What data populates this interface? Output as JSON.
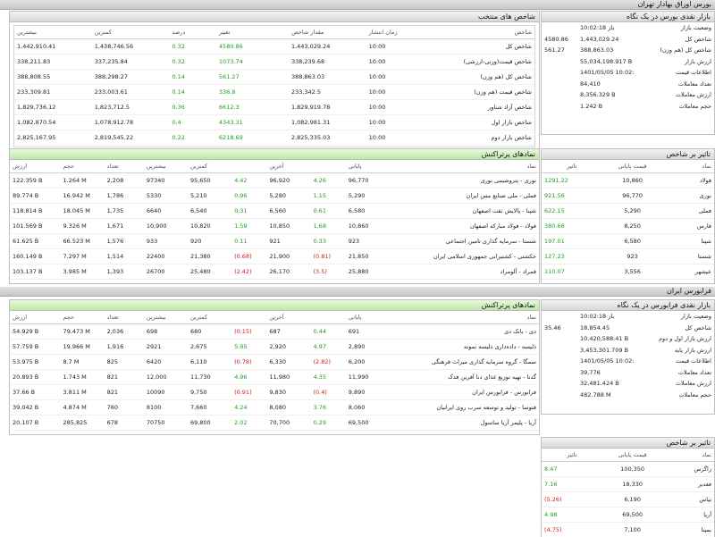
{
  "top_bar": "بورس اوراق بهادار تهران",
  "mid_bar": "فرابورس ایران",
  "tse_summary": {
    "title": "بازار نقدی بورس در یک نگاه",
    "rows": [
      {
        "label": "وضعیت بازار",
        "value": "باز 10:02:18",
        "change": ""
      },
      {
        "label": "شاخص کل",
        "value": "1,443,029.24",
        "change": "4580.86"
      },
      {
        "label": "شاخص کل (هم وزن)",
        "value": "388,863.03",
        "change": "561.27"
      },
      {
        "label": "ارزش بازار",
        "value": "55,034,198.917 B",
        "change": ""
      },
      {
        "label": "اطلاعات قیمت",
        "value": "1401/05/05 10:02:07",
        "change": ""
      },
      {
        "label": "تعداد معاملات",
        "value": "84,410",
        "change": ""
      },
      {
        "label": "ارزش معاملات",
        "value": "8,356.329 B",
        "change": ""
      },
      {
        "label": "حجم معاملات",
        "value": "1.242 B",
        "change": ""
      }
    ]
  },
  "indices": {
    "title": "شاخص های منتخب",
    "headers": [
      "شاخص",
      "زمان انتشار",
      "مقدار شاخص",
      "تغییر",
      "درصد",
      "کمترین",
      "بیشترین"
    ],
    "rows": [
      [
        "شاخص کل",
        "10:00",
        "1,443,029.24",
        "4580.86",
        "0.32",
        "1,438,746.56",
        "1,442,910.41"
      ],
      [
        "شاخص قیمت(وزنی-ارزشی)",
        "10:00",
        "338,239.68",
        "1073.74",
        "0.32",
        "337,235.84",
        "338,211.83"
      ],
      [
        "شاخص کل (هم وزن)",
        "10:00",
        "388,863.03",
        "561.27",
        "0.14",
        "388,298.27",
        "388,808.55"
      ],
      [
        "شاخص قیمت (هم وزن)",
        "10:00",
        "233,342.5",
        "336.8",
        "0.14",
        "233,003.61",
        "233,309.81"
      ],
      [
        "شاخص آزاد شناور",
        "10:00",
        "1,829,919.78",
        "6612.3",
        "0.36",
        "1,823,712.5",
        "1,829,736.12"
      ],
      [
        "شاخص بازار اول",
        "10:00",
        "1,082,981.31",
        "4343.31",
        "0.4",
        "1,078,912.78",
        "1,082,870.54"
      ],
      [
        "شاخص بازار دوم",
        "10:00",
        "2,825,335.03",
        "6218.69",
        "0.22",
        "2,819,545.22",
        "2,825,167.95"
      ]
    ]
  },
  "tse_impact": {
    "title": "تاثیر بر شاخص",
    "headers": [
      "نماد",
      "قیمت پایانی",
      "تاثیر"
    ],
    "rows": [
      [
        "فولاد",
        "10,860",
        "1291.22",
        "pos"
      ],
      [
        "نوری",
        "96,770",
        "921.56",
        "pos"
      ],
      [
        "فملی",
        "5,290",
        "622.15",
        "pos"
      ],
      [
        "فارس",
        "8,250",
        "380.68",
        "pos"
      ],
      [
        "شپنا",
        "6,580",
        "197.01",
        "pos"
      ],
      [
        "شستا",
        "923",
        "127.23",
        "pos"
      ],
      [
        "عیشهر",
        "3,556",
        "110.07",
        "pos"
      ]
    ]
  },
  "tse_top": {
    "title": "نمادهای پرتراکنش",
    "headers": [
      "نماد",
      "پایانی",
      "",
      "آخرین",
      "",
      "کمترین",
      "بیشترین",
      "تعداد",
      "حجم",
      "ارزش"
    ],
    "rows": [
      [
        "نوری - پتروشیمی نوری",
        "96,770",
        "4.26",
        "96,920",
        "4.42",
        "95,650",
        "97340",
        "2,208",
        "1.264 M",
        "122.359 B",
        "pos",
        "pos"
      ],
      [
        "فملی - ملی صنایع مس ایران",
        "5,290",
        "1.15",
        "5,280",
        "0.96",
        "5,210",
        "5330",
        "1,786",
        "16.942 M",
        "89.774 B",
        "pos",
        "pos"
      ],
      [
        "شپنا - پالایش نفت اصفهان",
        "6,580",
        "0.61",
        "6,560",
        "0.31",
        "6,540",
        "6640",
        "1,735",
        "18.045 M",
        "118.814 B",
        "pos",
        "pos"
      ],
      [
        "فولاد - فولاد مبارکه اصفهان",
        "10,860",
        "1.68",
        "10,850",
        "1.59",
        "10,820",
        "10,900",
        "1,671",
        "9.326 M",
        "101.569 B",
        "pos",
        "pos"
      ],
      [
        "شستا - سرمایه گذاری تامین اجتماعی",
        "923",
        "0.33",
        "921",
        "0.11",
        "920",
        "933",
        "1,576",
        "66.523 M",
        "61.625 B",
        "pos",
        "pos"
      ],
      [
        "حکشتی - کشتیرانی جمهوری اسلامی ایران",
        "21,850",
        "(0.81)",
        "21,900",
        "(0.68)",
        "21,380",
        "22400",
        "1,514",
        "7.297 M",
        "160.149 B",
        "neg",
        "neg"
      ],
      [
        "فمراد - آلومراد",
        "25,880",
        "(3.5)",
        "26,170",
        "(2.42)",
        "25,480",
        "26700",
        "1,393",
        "3.985 M",
        "103.137 B",
        "neg",
        "neg"
      ]
    ]
  },
  "ifb_summary": {
    "title": "بازار نقدی فرابورس در یک نگاه",
    "rows": [
      {
        "label": "وضعیت بازار",
        "value": "باز 10:02:18",
        "change": ""
      },
      {
        "label": "شاخص کل",
        "value": "18,854.45",
        "change": "35.46"
      },
      {
        "label": "ارزش بازار اول و دوم",
        "value": "10,420,588.41 B",
        "change": ""
      },
      {
        "label": "ارزش بازار پایه",
        "value": "3,453,301.709 B",
        "change": ""
      },
      {
        "label": "اطلاعات قیمت",
        "value": "1401/05/05 10:02:07",
        "change": ""
      },
      {
        "label": "تعداد معاملات",
        "value": "39,776",
        "change": ""
      },
      {
        "label": "ارزش معاملات",
        "value": "32,481.424 B",
        "change": ""
      },
      {
        "label": "حجم معاملات",
        "value": "482.788 M",
        "change": ""
      }
    ]
  },
  "ifb_top": {
    "title": "نمادهای پرتراکنش",
    "headers": [
      "نماد",
      "پایانی",
      "",
      "آخرین",
      "",
      "کمترین",
      "بیشترین",
      "تعداد",
      "حجم",
      "ارزش"
    ],
    "rows": [
      [
        "دی - بانک دی",
        "691",
        "0.44",
        "687",
        "(0.15)",
        "680",
        "698",
        "2,036",
        "79.473 M",
        "54.929 B",
        "pos",
        "neg"
      ],
      [
        "ذلیسه - داده‌داری ذلیسه نمونه",
        "2,890",
        "4.97",
        "2,920",
        "5.95",
        "2,675",
        "2921",
        "1,916",
        "19.966 M",
        "57.759 B",
        "pos",
        "pos"
      ],
      [
        "سمگا - گروه سرمایه گذاری میراث فرهنگی",
        "6,200",
        "(2.82)",
        "6,330",
        "(0.78)",
        "6,110",
        "6420",
        "825",
        "8.7 M",
        "53.975 B",
        "neg",
        "neg"
      ],
      [
        "گدنا - تهیه توزیع غذای دنا آفرین فدک",
        "11,990",
        "4.35",
        "11,980",
        "4.96",
        "11,730",
        "12,000",
        "821",
        "1.743 M",
        "20.893 B",
        "pos",
        "pos"
      ],
      [
        "فرابورس - فرابورس ایران",
        "9,890",
        "(0.4)",
        "9,830",
        "(0.91)",
        "9,750",
        "10090",
        "821",
        "3.811 M",
        "37.66 B",
        "neg",
        "neg"
      ],
      [
        "فنوسا - تولید و توسعه سرب روی ایرانیان",
        "8,060",
        "3.76",
        "8,080",
        "4.24",
        "7,660",
        "8100",
        "760",
        "4.874 M",
        "39.042 B",
        "pos",
        "pos"
      ],
      [
        "آریا - پلیمر آریا ساسول",
        "69,500",
        "0.29",
        "70,700",
        "2.02",
        "69,800",
        "70750",
        "678",
        "285,825",
        "20.107 B",
        "pos",
        "pos"
      ]
    ]
  },
  "ifb_impact": {
    "title": "تاثیر بر شاخص",
    "headers": [
      "نماد",
      "قیمت پایانی",
      "تاثیر"
    ],
    "rows": [
      [
        "زاگرس",
        "100,350",
        "8.47",
        "pos"
      ],
      [
        "فغدیر",
        "18,330",
        "7.16",
        "pos"
      ],
      [
        "بپاس",
        "6,190",
        "(5.26)",
        "neg"
      ],
      [
        "آریا",
        "69,500",
        "4.98",
        "pos"
      ],
      [
        "بمپنا",
        "7,100",
        "(4.75)",
        "neg"
      ]
    ]
  }
}
